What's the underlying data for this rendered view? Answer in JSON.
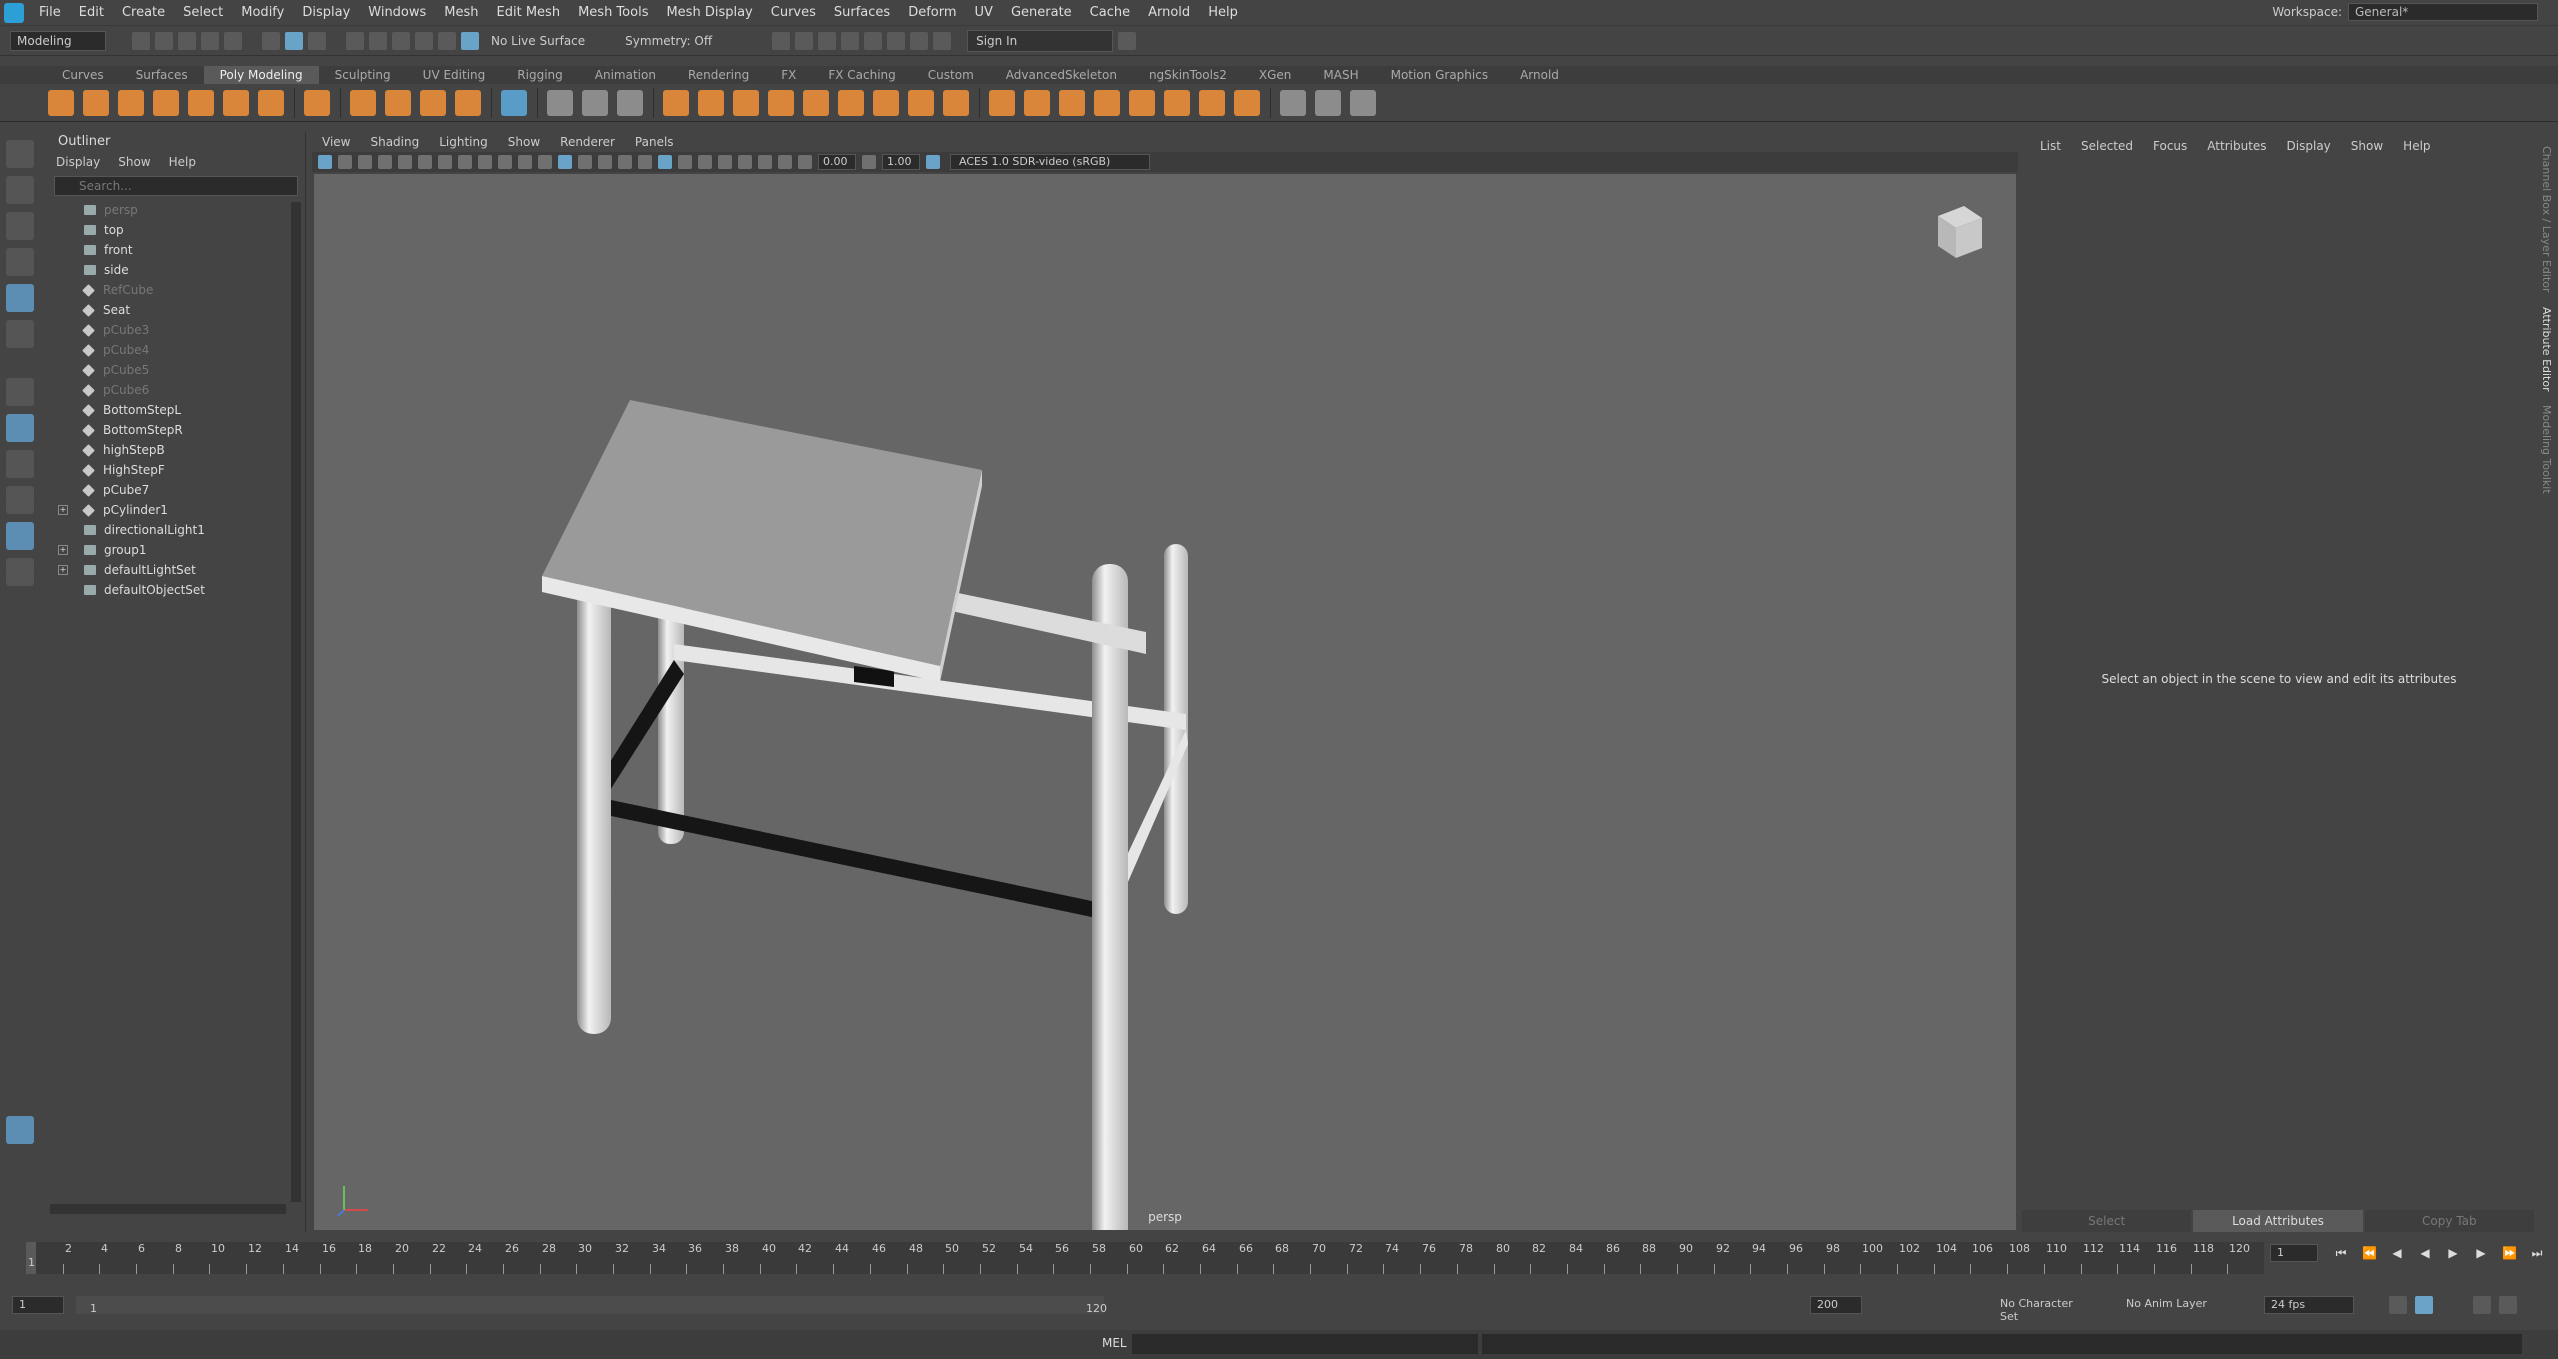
{
  "menubar": {
    "items": [
      "File",
      "Edit",
      "Create",
      "Select",
      "Modify",
      "Display",
      "Windows",
      "Mesh",
      "Edit Mesh",
      "Mesh Tools",
      "Mesh Display",
      "Curves",
      "Surfaces",
      "Deform",
      "UV",
      "Generate",
      "Cache",
      "Arnold",
      "Help"
    ],
    "workspace_label": "Workspace:",
    "workspace_value": "General*"
  },
  "statusline": {
    "mode": "Modeling",
    "live_surface": "No Live Surface",
    "symmetry": "Symmetry: Off",
    "sign_in": "Sign In"
  },
  "shelf": {
    "tabs": [
      "Curves",
      "Surfaces",
      "Poly Modeling",
      "Sculpting",
      "UV Editing",
      "Rigging",
      "Animation",
      "Rendering",
      "FX",
      "FX Caching",
      "Custom",
      "AdvancedSkeleton",
      "ngSkinTools2",
      "XGen",
      "MASH",
      "Motion Graphics",
      "Arnold"
    ],
    "active": "Poly Modeling"
  },
  "outliner": {
    "title": "Outliner",
    "menu": [
      "Display",
      "Show",
      "Help"
    ],
    "search_placeholder": "Search...",
    "items": [
      {
        "label": "persp",
        "icon": "camera-icon",
        "dim": true,
        "expand": false
      },
      {
        "label": "top",
        "icon": "camera-icon",
        "dim": false,
        "expand": false
      },
      {
        "label": "front",
        "icon": "camera-icon",
        "dim": false,
        "expand": false
      },
      {
        "label": "side",
        "icon": "camera-icon",
        "dim": false,
        "expand": false
      },
      {
        "label": "RefCube",
        "icon": "mesh-icon",
        "dim": true,
        "expand": false
      },
      {
        "label": "Seat",
        "icon": "mesh-icon",
        "dim": false,
        "expand": false
      },
      {
        "label": "pCube3",
        "icon": "mesh-icon",
        "dim": true,
        "expand": false
      },
      {
        "label": "pCube4",
        "icon": "mesh-icon",
        "dim": true,
        "expand": false
      },
      {
        "label": "pCube5",
        "icon": "mesh-icon",
        "dim": true,
        "expand": false
      },
      {
        "label": "pCube6",
        "icon": "mesh-icon",
        "dim": true,
        "expand": false
      },
      {
        "label": "BottomStepL",
        "icon": "mesh-icon",
        "dim": false,
        "expand": false
      },
      {
        "label": "BottomStepR",
        "icon": "mesh-icon",
        "dim": false,
        "expand": false
      },
      {
        "label": "highStepB",
        "icon": "mesh-icon",
        "dim": false,
        "expand": false
      },
      {
        "label": "HighStepF",
        "icon": "mesh-icon",
        "dim": false,
        "expand": false
      },
      {
        "label": "pCube7",
        "icon": "mesh-icon",
        "dim": false,
        "expand": false
      },
      {
        "label": "pCylinder1",
        "icon": "mesh-icon",
        "dim": false,
        "expand": true
      },
      {
        "label": "directionalLight1",
        "icon": "light-icon",
        "dim": false,
        "expand": false
      },
      {
        "label": "group1",
        "icon": "group-icon",
        "dim": false,
        "expand": true
      },
      {
        "label": "defaultLightSet",
        "icon": "set-icon",
        "dim": false,
        "expand": true
      },
      {
        "label": "defaultObjectSet",
        "icon": "set-icon",
        "dim": false,
        "expand": false
      }
    ]
  },
  "viewport": {
    "menu": [
      "View",
      "Shading",
      "Lighting",
      "Show",
      "Renderer",
      "Panels"
    ],
    "near": "0.00",
    "far": "1.00",
    "colorspace": "ACES 1.0 SDR-video (sRGB)",
    "camera_label": "persp"
  },
  "attr": {
    "menu": [
      "List",
      "Selected",
      "Focus",
      "Attributes",
      "Display",
      "Show",
      "Help"
    ],
    "message": "Select an object in the scene to view and edit its attributes",
    "buttons": [
      "Select",
      "Load Attributes",
      "Copy Tab"
    ]
  },
  "side_tabs": [
    "Channel Box / Layer Editor",
    "Attribute Editor",
    "Modeling Toolkit"
  ],
  "timeline": {
    "ticks": [
      "2",
      "4",
      "6",
      "8",
      "10",
      "12",
      "14",
      "16",
      "18",
      "20",
      "22",
      "24",
      "26",
      "28",
      "30",
      "32",
      "34",
      "36",
      "38",
      "40",
      "42",
      "44",
      "46",
      "48",
      "50",
      "52",
      "54",
      "56",
      "58",
      "60",
      "62",
      "64",
      "66",
      "68",
      "70",
      "72",
      "74",
      "76",
      "78",
      "80",
      "82",
      "84",
      "86",
      "88",
      "90",
      "92",
      "94",
      "96",
      "98",
      "100",
      "102",
      "104",
      "106",
      "108",
      "110",
      "112",
      "114",
      "116",
      "118",
      "120"
    ],
    "current": "1",
    "playhead": "1"
  },
  "range": {
    "start": "1",
    "inner_start": "1",
    "inner_end": "120",
    "end": "200",
    "char_set": "No Character Set",
    "anim_layer": "No Anim Layer",
    "fps": "24 fps"
  },
  "cmd": {
    "lang": "MEL"
  }
}
